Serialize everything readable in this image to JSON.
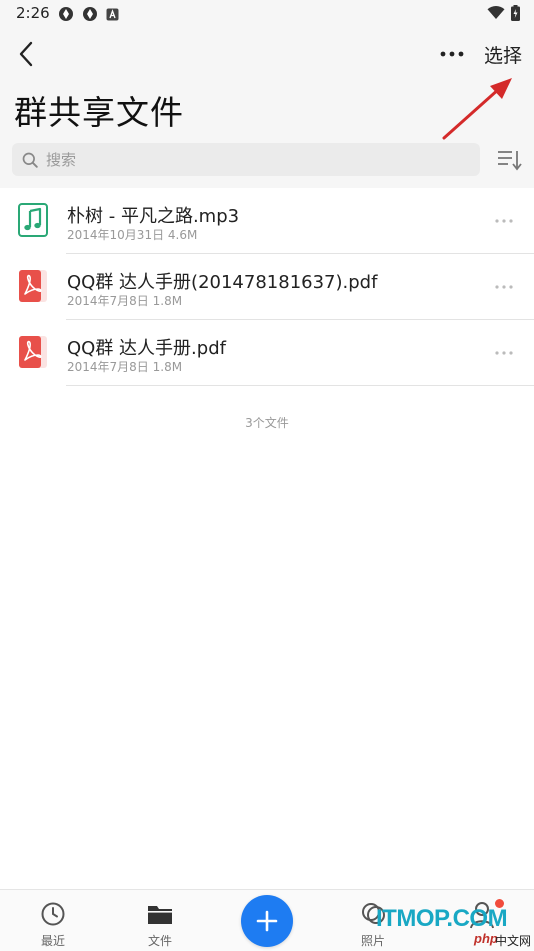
{
  "status_bar": {
    "time": "2:26"
  },
  "header": {
    "back_icon": "chevron-left-icon",
    "more_icon": "more-horizontal-icon",
    "select_label": "选择",
    "title": "群共享文件"
  },
  "search": {
    "placeholder": "搜索"
  },
  "files": [
    {
      "name": "朴树 - 平凡之路.mp3",
      "meta": "2014年10月31日  4.6M",
      "type": "music-file-icon"
    },
    {
      "name": "QQ群 达人手册(201478181637).pdf",
      "meta": "2014年7月8日  1.8M",
      "type": "pdf-file-icon"
    },
    {
      "name": "QQ群 达人手册.pdf",
      "meta": "2014年7月8日  1.8M",
      "type": "pdf-file-icon"
    }
  ],
  "file_count": "3个文件",
  "tabs": [
    {
      "label": "最近",
      "icon": "clock-icon"
    },
    {
      "label": "文件",
      "icon": "folder-icon"
    },
    {
      "label": "照片",
      "icon": "photo-icon"
    }
  ],
  "fab_icon": "plus-icon",
  "watermark": {
    "main": "ITMOP.COM",
    "php": "php",
    "cn": "中文网"
  },
  "colors": {
    "accent": "#1e7cf2",
    "music_icon": "#2aa876",
    "pdf_icon": "#e8504a",
    "notification": "#f14c3c",
    "annotation_arrow": "#d42a2a"
  }
}
